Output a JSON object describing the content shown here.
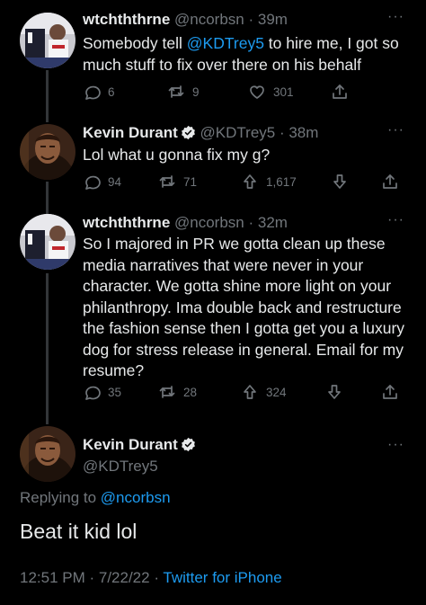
{
  "tweets": [
    {
      "name": "wtchththrne",
      "handle": "@ncorbsn",
      "time": "39m",
      "text_parts": [
        "Somebody tell ",
        "@KDTrey5",
        " to hire me, I got so much stuff to fix over there on his behalf"
      ],
      "replies": "6",
      "retweets": "9",
      "likes": "301"
    },
    {
      "name": "Kevin Durant",
      "handle": "@KDTrey5",
      "time": "38m",
      "text": "Lol what u gonna fix my g?",
      "replies": "94",
      "retweets": "71",
      "upvotes": "1,617"
    },
    {
      "name": "wtchththrne",
      "handle": "@ncorbsn",
      "time": "32m",
      "text": "So I majored in PR we gotta clean up these media narratives that were never in your character. We gotta shine more light on your philanthropy. Ima double back and restructure the fashion sense then I gotta get you a luxury dog for stress release in general. Email for my resume?",
      "replies": "35",
      "retweets": "28",
      "upvotes": "324"
    }
  ],
  "main_tweet": {
    "name": "Kevin Durant",
    "handle": "@KDTrey5",
    "replying_prefix": "Replying to ",
    "replying_handle": "@ncorbsn",
    "text": "Beat it kid lol",
    "timestamp": "12:51 PM · 7/22/22 · ",
    "source": "Twitter for iPhone"
  },
  "separator": "·",
  "more_glyph": "···",
  "colors": {
    "accent": "#1d9bf0",
    "muted": "#71767b",
    "text": "#e7e9ea",
    "background": "#000000"
  },
  "icons": [
    "reply-icon",
    "retweet-icon",
    "like-icon",
    "upvote-icon",
    "downvote-icon",
    "share-icon",
    "verified-icon",
    "more-icon"
  ]
}
